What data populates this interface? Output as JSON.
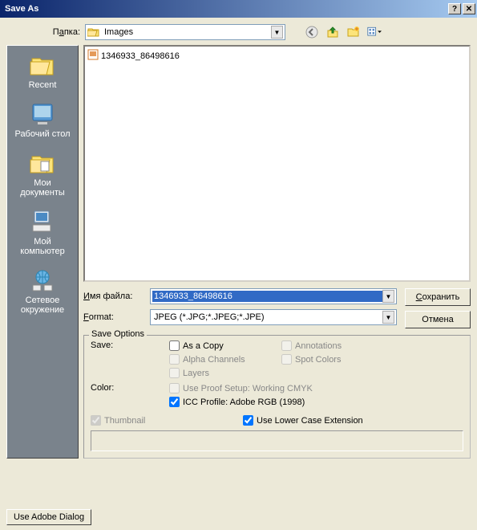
{
  "title": "Save As",
  "folder": {
    "label_pre": "П",
    "label_u": "а",
    "label_post": "пка:",
    "value": "Images"
  },
  "file_list": [
    {
      "name": "1346933_86498616"
    }
  ],
  "places": [
    {
      "id": "recent",
      "label": "Recent"
    },
    {
      "id": "desktop",
      "label": "Рабочий стол"
    },
    {
      "id": "mydocs",
      "label": "Мои документы"
    },
    {
      "id": "mycomp",
      "label": "Мой компьютер"
    },
    {
      "id": "network",
      "label": "Сетевое окружение"
    }
  ],
  "filename": {
    "label_pre": "",
    "label_u": "И",
    "label_post": "мя файла:",
    "value": "1346933_86498616"
  },
  "format": {
    "label_pre": "",
    "label_u": "F",
    "label_post": "ormat:",
    "value": "JPEG (*.JPG;*.JPEG;*.JPE)"
  },
  "buttons": {
    "save_pre": "",
    "save_u": "С",
    "save_post": "охранить",
    "cancel": "Отмена",
    "adobe": "Use Adobe Dialog"
  },
  "options": {
    "legend": "Save Options",
    "save_label": "Save:",
    "color_label": "Color:",
    "as_copy": "As a Copy",
    "alpha": "Alpha Channels",
    "layers": "Layers",
    "annotations": "Annotations",
    "spot": "Spot Colors",
    "proof": "Use Proof Setup:  Working CMYK",
    "icc": "ICC Profile:  Adobe RGB (1998)",
    "thumbnail": "Thumbnail",
    "lowercase": "Use Lower Case Extension"
  }
}
